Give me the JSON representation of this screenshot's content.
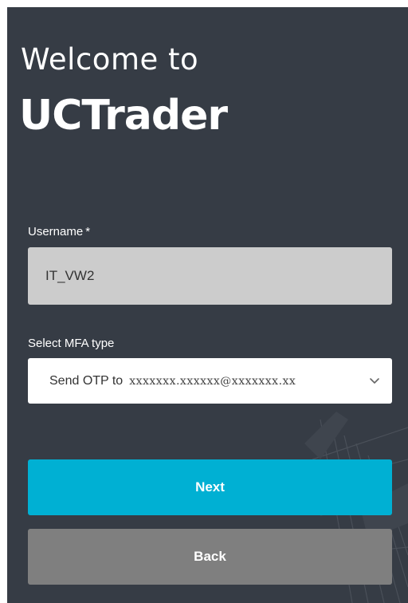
{
  "header": {
    "welcome": "Welcome to",
    "brand": "UCTrader"
  },
  "form": {
    "username_label": "Username",
    "required_mark": "*",
    "username_value": "IT_VW2",
    "mfa_label": "Select MFA type",
    "mfa_selected_prefix": "Send OTP to",
    "mfa_selected_email": "xxxxxxx.xxxxxx@xxxxxxx.xx"
  },
  "buttons": {
    "next_label": "Next",
    "back_label": "Back"
  },
  "icons": {
    "dropdown": "chevron-down-icon"
  },
  "colors": {
    "panel_background": "#363c45",
    "username_background": "#cccccc",
    "next_button": "#00b0d3",
    "back_button": "#7f7f7f",
    "text_light": "#ffffff"
  }
}
